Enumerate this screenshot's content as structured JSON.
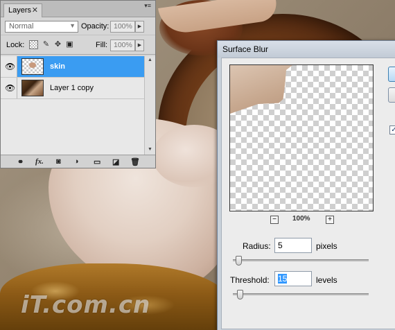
{
  "layers_panel": {
    "tab_label": "Layers",
    "tab_close": "✕",
    "menu_icon": "▾≡",
    "blend_mode": "Normal",
    "opacity_label": "Opacity:",
    "opacity_value": "100%",
    "lock_label": "Lock:",
    "fill_label": "Fill:",
    "fill_value": "100%",
    "layers": [
      {
        "name": "skin",
        "selected": true,
        "visible": true
      },
      {
        "name": "Layer 1 copy",
        "selected": false,
        "visible": true
      }
    ],
    "footer_icons": [
      "link-layers-icon",
      "fx-icon",
      "add-mask-icon",
      "adjustment-layer-icon",
      "new-group-icon",
      "new-layer-icon",
      "trash-icon"
    ],
    "footer_fx_label": "fx."
  },
  "dialog": {
    "title": "Surface Blur",
    "zoom_level": "100%",
    "zoom_out": "−",
    "zoom_in": "+",
    "radius_label": "Radius:",
    "radius_value": "5",
    "radius_unit": "pixels",
    "threshold_label": "Threshold:",
    "threshold_value": "15",
    "threshold_unit": "levels",
    "preview_checked": "✓"
  },
  "watermark": "iT.com.cn",
  "colors": {
    "selection": "#3a9cf2",
    "dialog_frame": "#c9d1da"
  }
}
